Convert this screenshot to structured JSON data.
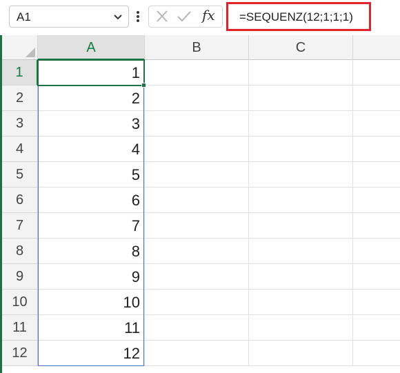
{
  "name_box": {
    "value": "A1"
  },
  "formula_bar": {
    "value": "=SEQUENZ(12;1;1;1)",
    "fx_label": "fx",
    "highlight_color": "#e3232c"
  },
  "icons": {
    "name_box_dropdown": "chevron-down-icon",
    "more": "vertical-dots-icon",
    "cancel": "cancel-x-icon",
    "enter": "check-icon"
  },
  "columns": [
    "A",
    "B",
    "C"
  ],
  "rows": [
    {
      "header": "1",
      "a": "1"
    },
    {
      "header": "2",
      "a": "2"
    },
    {
      "header": "3",
      "a": "3"
    },
    {
      "header": "4",
      "a": "4"
    },
    {
      "header": "5",
      "a": "5"
    },
    {
      "header": "6",
      "a": "6"
    },
    {
      "header": "7",
      "a": "7"
    },
    {
      "header": "8",
      "a": "8"
    },
    {
      "header": "9",
      "a": "9"
    },
    {
      "header": "10",
      "a": "10"
    },
    {
      "header": "11",
      "a": "11"
    },
    {
      "header": "12",
      "a": "12"
    }
  ],
  "colors": {
    "accent": "#107c41",
    "spill_border": "#4472c4"
  }
}
